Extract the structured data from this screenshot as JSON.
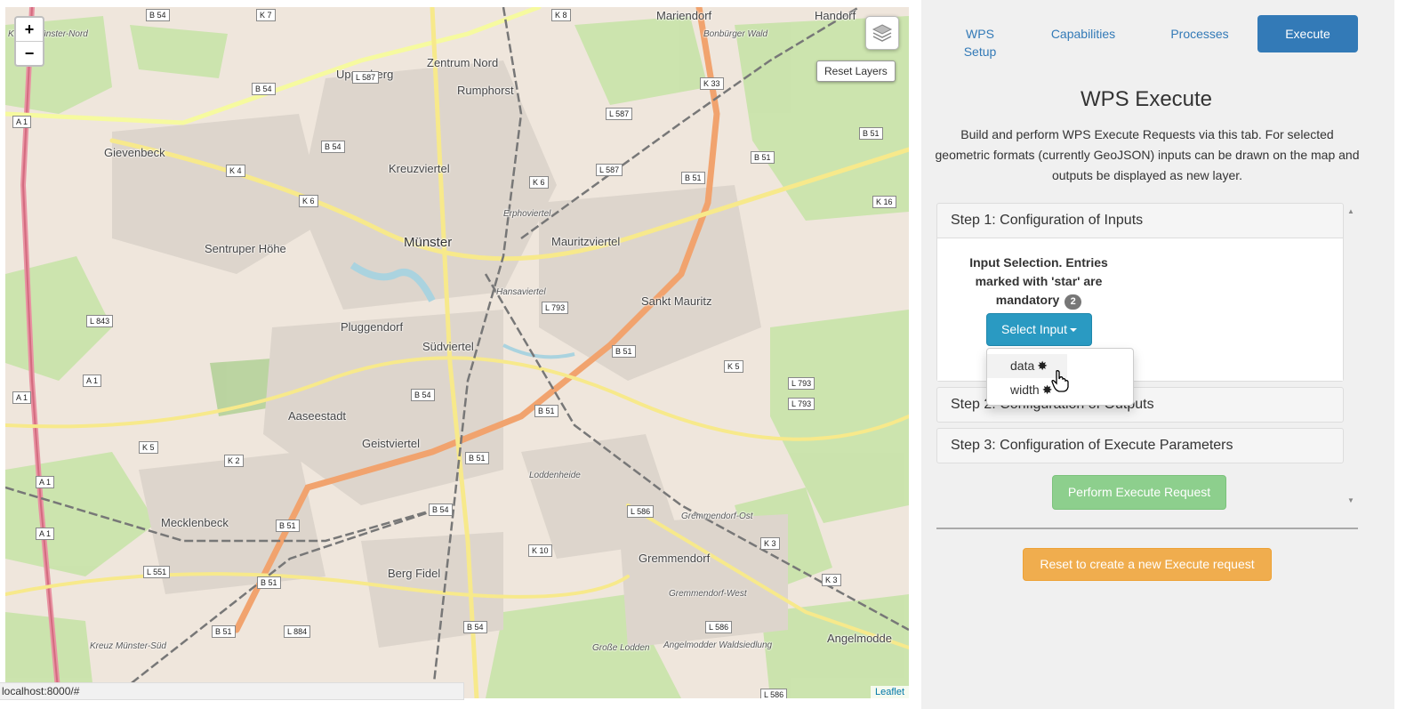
{
  "map": {
    "zoom_in": "+",
    "zoom_out": "−",
    "reset_layers": "Reset Layers",
    "attribution": "Leaflet",
    "places": [
      {
        "name": "Mariendorf",
        "cls": ""
      },
      {
        "name": "Handorf",
        "cls": ""
      },
      {
        "name": "Zentrum Nord",
        "cls": ""
      },
      {
        "name": "Uppenberg",
        "cls": ""
      },
      {
        "name": "Rumphorst",
        "cls": ""
      },
      {
        "name": "Gievenbeck",
        "cls": ""
      },
      {
        "name": "Kreuzviertel",
        "cls": ""
      },
      {
        "name": "Sentruper Höhe",
        "cls": ""
      },
      {
        "name": "Münster",
        "cls": "big"
      },
      {
        "name": "Mauritzviertel",
        "cls": ""
      },
      {
        "name": "Sankt Mauritz",
        "cls": ""
      },
      {
        "name": "Pluggendorf",
        "cls": ""
      },
      {
        "name": "Südviertel",
        "cls": ""
      },
      {
        "name": "Aaseestadt",
        "cls": ""
      },
      {
        "name": "Geistviertel",
        "cls": ""
      },
      {
        "name": "Mecklenbeck",
        "cls": ""
      },
      {
        "name": "Gremmendorf",
        "cls": ""
      },
      {
        "name": "Berg Fidel",
        "cls": ""
      },
      {
        "name": "Angelmodde",
        "cls": ""
      },
      {
        "name": "Erphoviertel",
        "cls": "small"
      },
      {
        "name": "Hansaviertel",
        "cls": "small"
      },
      {
        "name": "Loddenheide",
        "cls": "small"
      },
      {
        "name": "Gremmendorf-Ost",
        "cls": "small"
      },
      {
        "name": "Gremmendorf-West",
        "cls": "small"
      },
      {
        "name": "Große Lodden",
        "cls": "small"
      },
      {
        "name": "Angelmodder Waldsiedlung",
        "cls": "small"
      },
      {
        "name": "Bonbürger Wald",
        "cls": "small"
      },
      {
        "name": "Kreuz Münster-Nord",
        "cls": "small"
      },
      {
        "name": "Kreuz Münster-Süd",
        "cls": "small"
      }
    ],
    "roads": [
      "B 54",
      "K 7",
      "K 8",
      "L 587",
      "L 587",
      "B 54",
      "K 33",
      "A 1",
      "B 54",
      "B 51",
      "K 4",
      "K 6",
      "L 587",
      "B 51",
      "B 51",
      "K 6",
      "K 16",
      "A 1",
      "L 843",
      "L 793",
      "K 5",
      "B 51",
      "L 793",
      "A 1",
      "B 54",
      "B 51",
      "L 793",
      "K 5",
      "K 2",
      "B 51",
      "A 1",
      "B 54",
      "L 586",
      "B 51",
      "A 1",
      "K 10",
      "K 3",
      "L 551",
      "B 51",
      "K 3",
      "B 51",
      "L 884",
      "B 54",
      "L 586",
      "L 586"
    ]
  },
  "status_url": "localhost:8000/#",
  "nav": {
    "tabs": [
      {
        "label": "WPS Setup",
        "active": false
      },
      {
        "label": "Capabilities",
        "active": false
      },
      {
        "label": "Processes",
        "active": false
      },
      {
        "label": "Execute",
        "active": true
      }
    ]
  },
  "execute": {
    "title": "WPS Execute",
    "description": "Build and perform WPS Execute Requests via this tab. For selected geometric formats (currently GeoJSON) inputs can be drawn on the map and outputs be displayed as new layer.",
    "step1": "Step 1: Configuration of Inputs",
    "input_selection": "Input Selection. Entries marked with 'star' are mandatory",
    "badge_count": "2",
    "select_input": "Select Input",
    "dropdown": [
      {
        "label": "data",
        "star": "✸"
      },
      {
        "label": "width",
        "star": "✸"
      }
    ],
    "step2": "Step 2: Configuration of Outputs",
    "step3": "Step 3: Configuration of Execute Parameters",
    "perform": "Perform Execute Request",
    "reset": "Reset to create a new Execute request"
  }
}
